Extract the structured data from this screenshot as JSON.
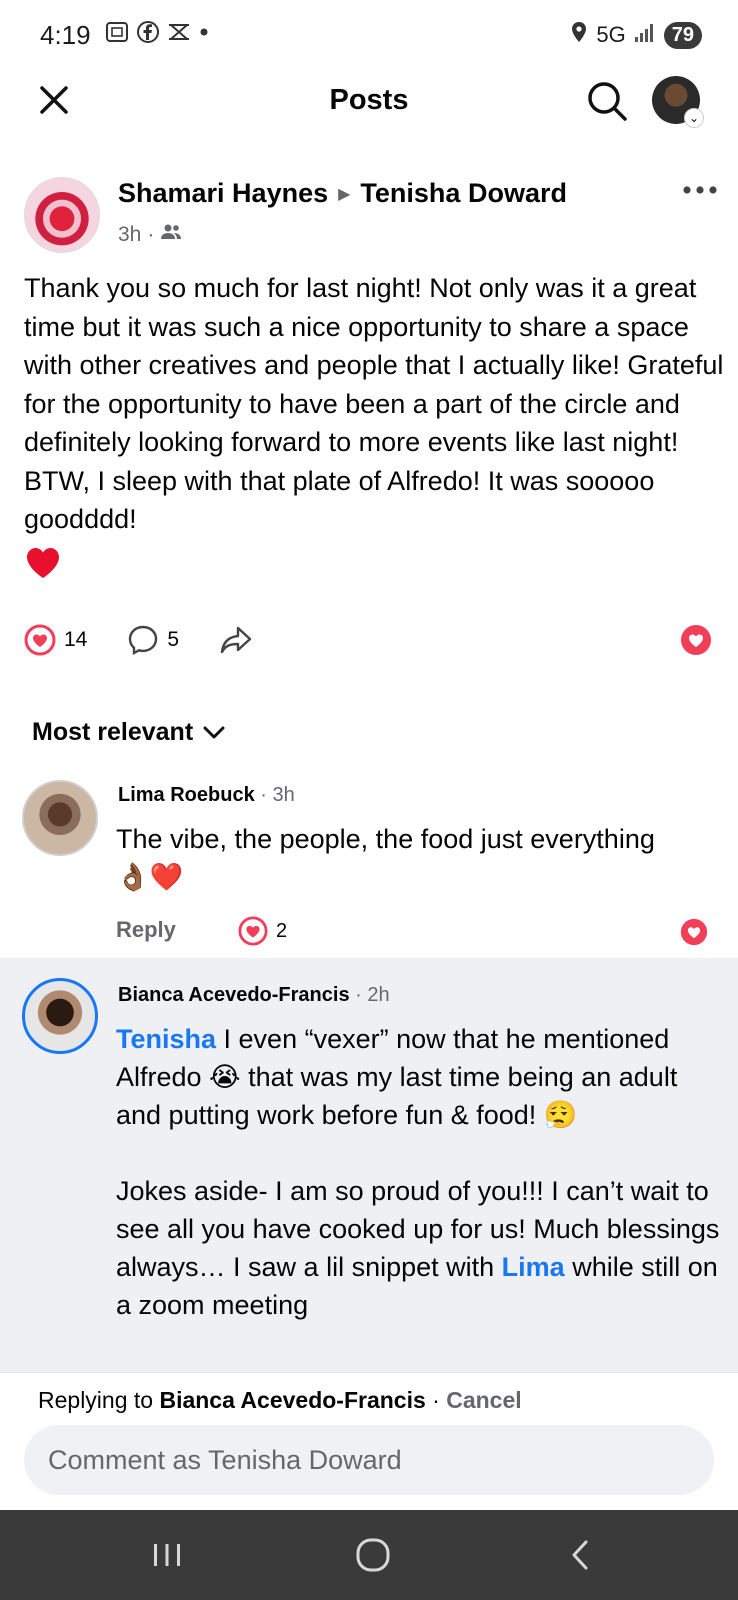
{
  "status_bar": {
    "time": "4:19",
    "network": "5G",
    "battery": "79"
  },
  "header": {
    "title": "Posts"
  },
  "post": {
    "author": "Shamari Haynes",
    "recipient": "Tenisha Doward",
    "time": "3h",
    "audience_sep": "·",
    "text": "Thank you so much for last night! Not only was it a great time but it was such a nice opportunity to share a space with other creatives and people that I actually like! Grateful for the opportunity to have been a part of the circle and definitely looking forward to more events like last night! BTW, I sleep with that plate of Alfredo! It was sooooo goodddd!",
    "reaction_count": "14",
    "comment_count": "5"
  },
  "sort": {
    "label": "Most relevant"
  },
  "comments": [
    {
      "name": "Lima Roebuck",
      "time": "· 3h",
      "text": "The vibe, the people, the food just everything",
      "emojis": "👌🏾❤️",
      "reply_label": "Reply",
      "reaction_count": "2"
    },
    {
      "name": "Bianca Acevedo-Francis",
      "time": "· 2h",
      "mention1": "Tenisha",
      "text1": " I even “vexer” now that he mentioned Alfredo 😭 that was my last time being an adult and putting work before fun & food! 😮‍💨",
      "text2a": "Jokes aside- I am so proud of you!!! I can’t wait to see all you have cooked up for us! Much blessings always… I saw a lil snippet with ",
      "mention2": "Lima",
      "text2b": " while still on a zoom  meeting"
    }
  ],
  "reply_bar": {
    "prefix": "Replying to ",
    "target": "Bianca Acevedo-Francis",
    "separator": " · ",
    "cancel": "Cancel",
    "placeholder": "Comment as Tenisha Doward"
  },
  "colors": {
    "accent": "#1877f2",
    "love": "#f33e58",
    "highlight_bg": "#eef0f4",
    "nav_bg": "#3a3a3a"
  }
}
